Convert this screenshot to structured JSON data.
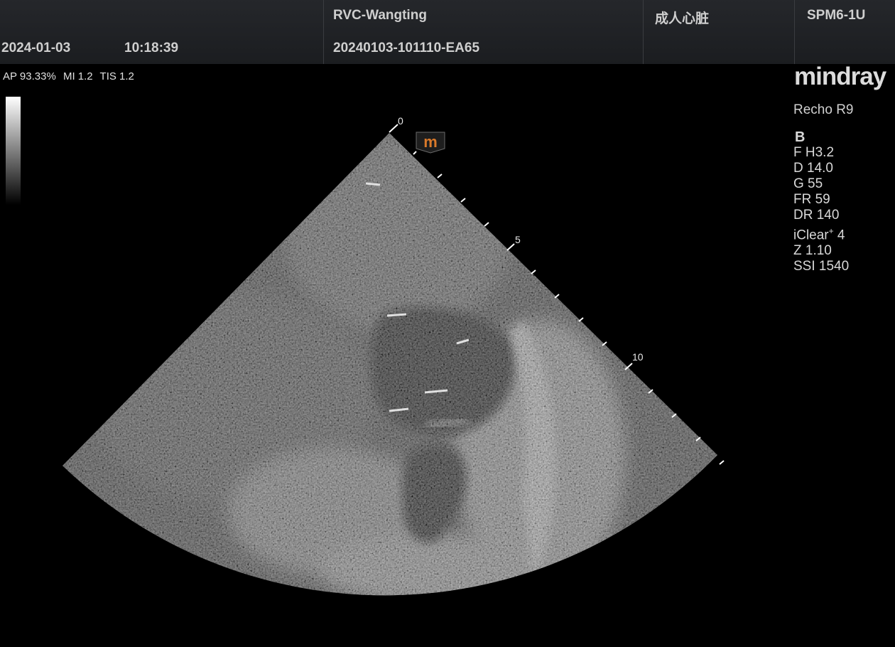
{
  "header": {
    "date": "2024-01-03",
    "time": "10:18:39",
    "hospital": "RVC-Wangting",
    "exam_id": "20240103-101110-EA65",
    "exam_type": "成人心脏",
    "probe": "SPM6-1U"
  },
  "acoustic": {
    "ap": "AP 93.33%",
    "mi": "MI 1.2",
    "tis": "TIS 1.2"
  },
  "brand": {
    "logo": "mindray",
    "model": "Recho R9"
  },
  "imaging_params": {
    "mode": "B",
    "freq": "F H3.2",
    "depth": "D 14.0",
    "gain": "G 55",
    "frame_rate": "FR 59",
    "dynamic_range": "DR 140",
    "iclear_name": "iClear",
    "iclear_sup": "+",
    "iclear_value": "4",
    "zoom": "Z 1.10",
    "ssi": "SSI 1540"
  },
  "depth_scale": {
    "label_0": "0",
    "label_5": "5",
    "label_10": "10"
  },
  "orientation_marker": "m"
}
